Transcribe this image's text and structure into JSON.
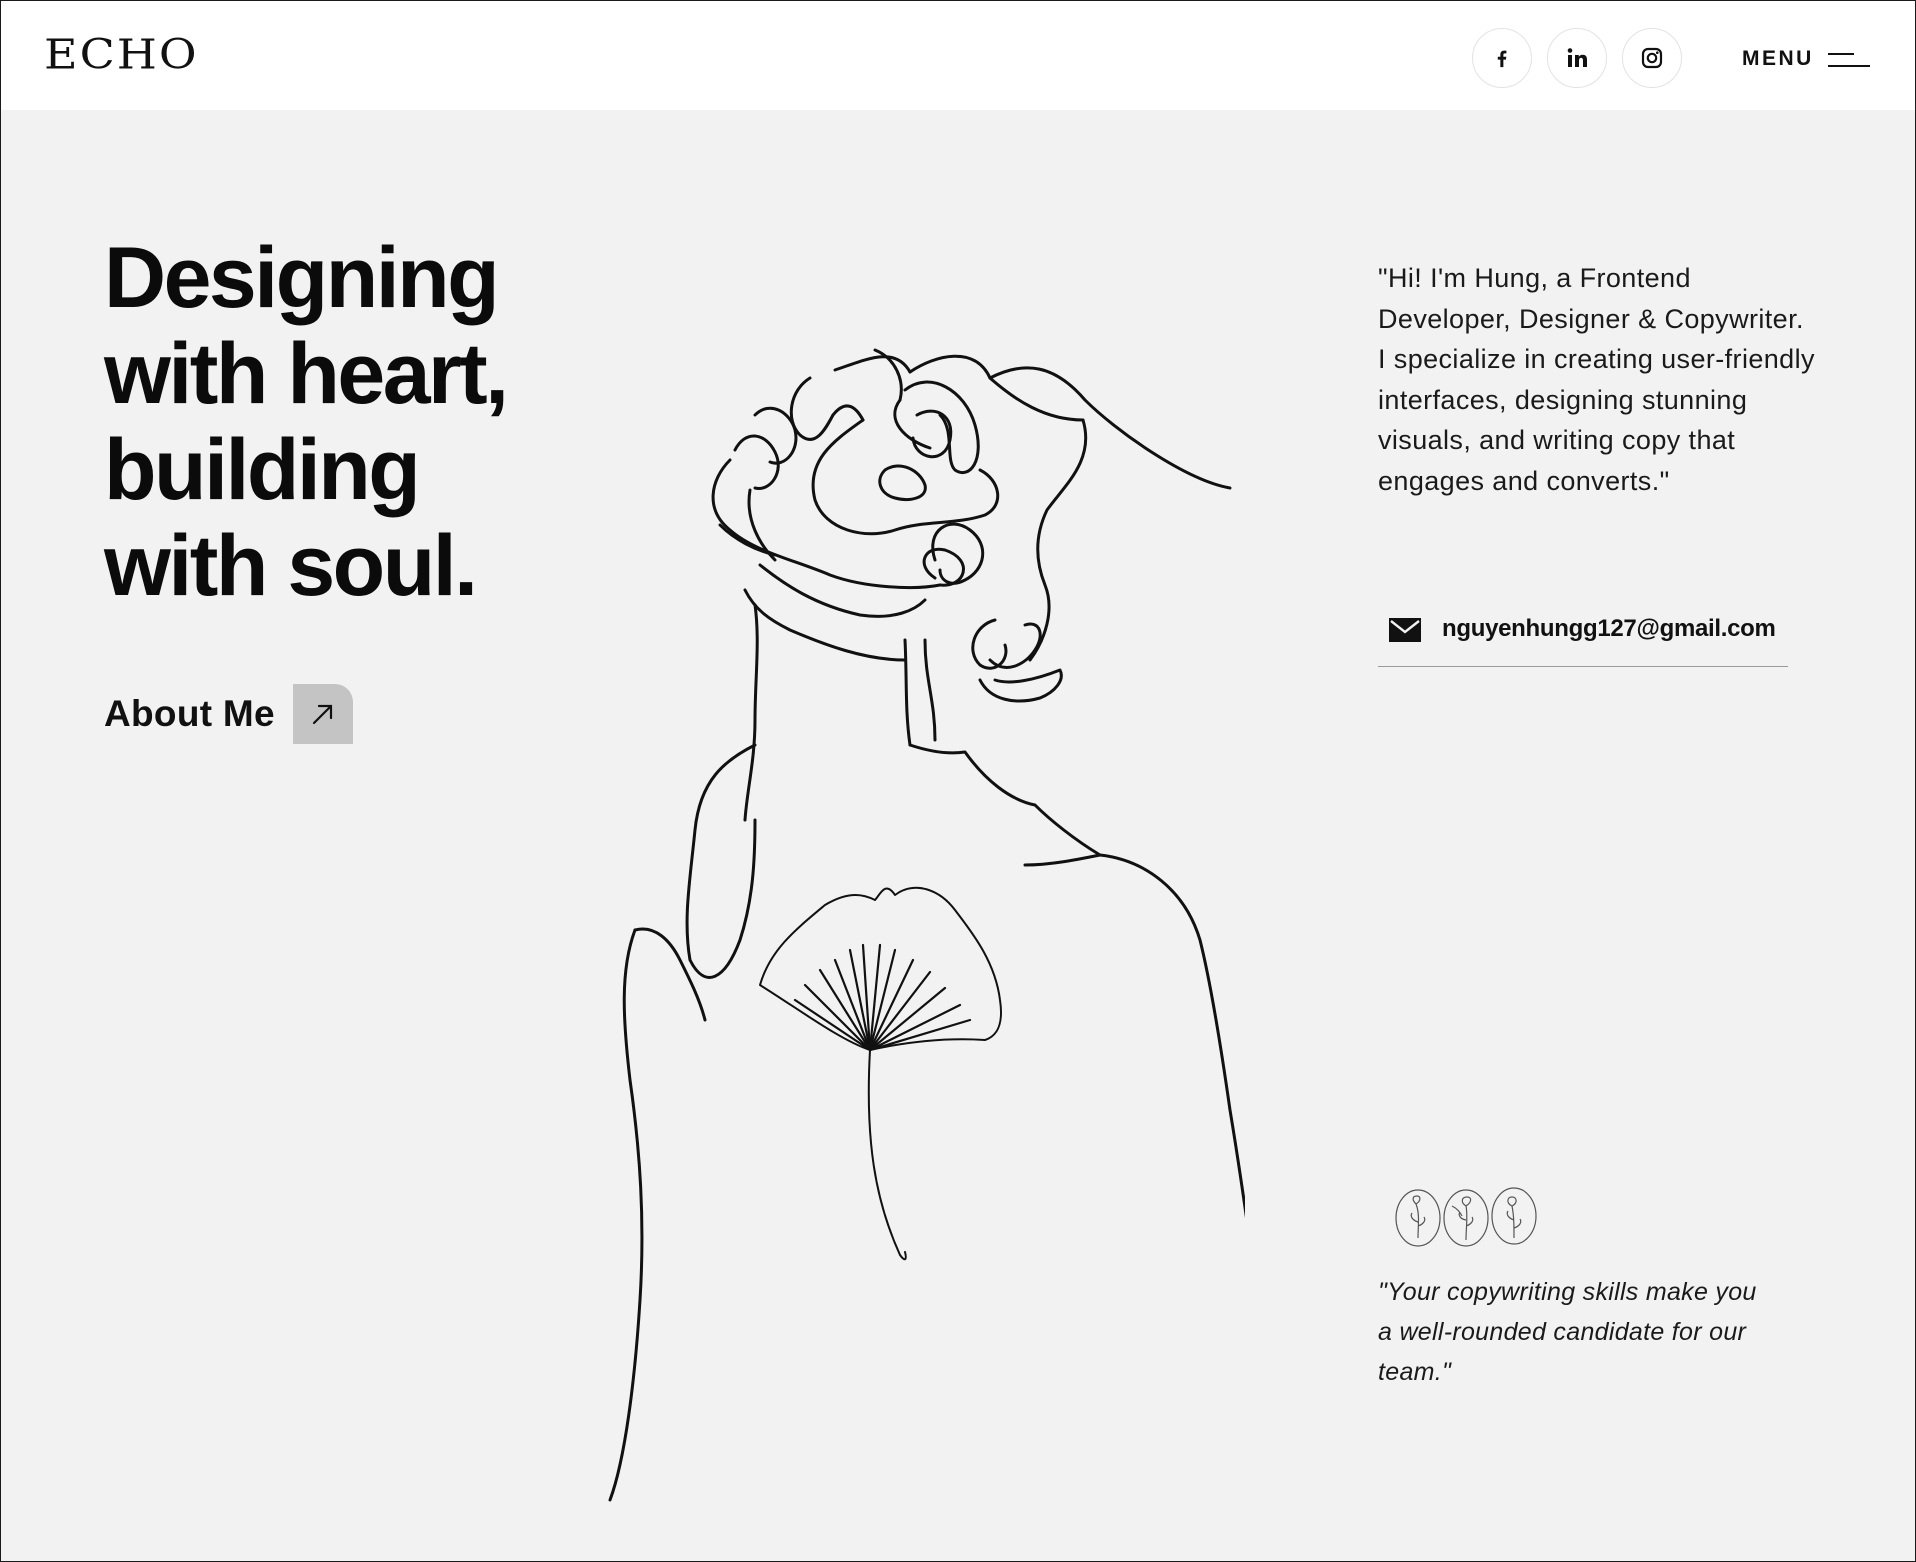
{
  "header": {
    "logo": "ECHO",
    "social": [
      {
        "name": "facebook",
        "icon": "facebook-icon"
      },
      {
        "name": "linkedin",
        "icon": "linkedin-icon"
      },
      {
        "name": "instagram",
        "icon": "instagram-icon"
      }
    ],
    "menu_label": "MENU",
    "menu_icon": "hamburger-menu-icon"
  },
  "hero": {
    "title_lines": [
      "Designing",
      "with heart,",
      "building",
      "with soul."
    ],
    "about_label": "About Me",
    "about_icon": "arrow-up-right-icon"
  },
  "illustration": {
    "icon": "line-art-portrait-with-ginkgo-leaf"
  },
  "bio": {
    "text": "\"Hi! I'm Hung, a Frontend Developer, Designer & Copywriter. I specialize in creating user-friendly interfaces, designing stunning visuals, and writing copy that engages and converts.\"",
    "email": "nguyenhungg127@gmail.com",
    "email_icon": "envelope-icon"
  },
  "testimonial": {
    "badges_icon": "floral-badges-icon",
    "quote": "\"Your copywriting skills make you a well-rounded candidate for our team.\""
  },
  "colors": {
    "background": "#f2f2f2",
    "header_bg": "#ffffff",
    "text": "#111111",
    "arrow_button": "#c4c4c4"
  }
}
